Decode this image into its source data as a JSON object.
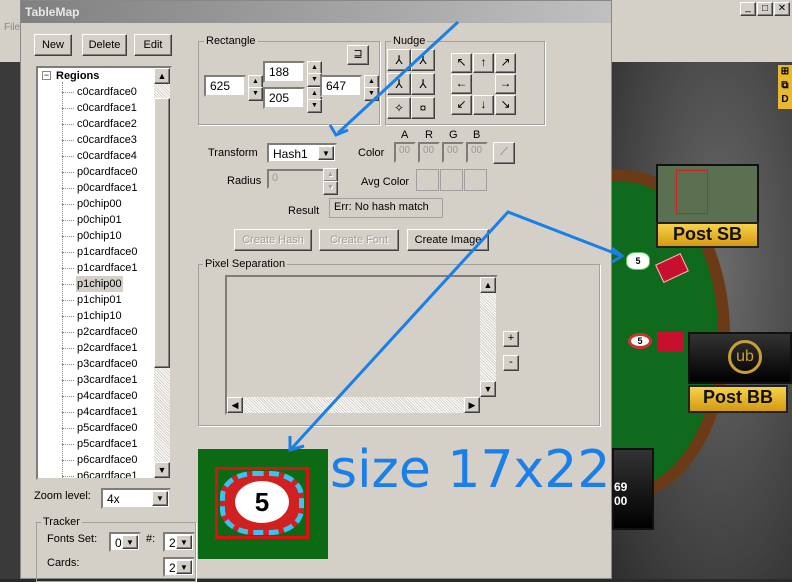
{
  "window": {
    "title": "TableMap",
    "menu_file": "File",
    "min": "_",
    "max": "□",
    "close": "✕"
  },
  "toolbar": {
    "new": "New",
    "delete": "Delete",
    "edit": "Edit"
  },
  "tree": {
    "root": "Regions",
    "items": [
      "c0cardface0",
      "c0cardface1",
      "c0cardface2",
      "c0cardface3",
      "c0cardface4",
      "p0cardface0",
      "p0cardface1",
      "p0chip00",
      "p0chip01",
      "p0chip10",
      "p1cardface0",
      "p1cardface1",
      "p1chip00",
      "p1chip01",
      "p1chip10",
      "p2cardface0",
      "p2cardface1",
      "p3cardface0",
      "p3cardface1",
      "p4cardface0",
      "p4cardface1",
      "p5cardface0",
      "p5cardface1",
      "p6cardface0",
      "p6cardface1"
    ],
    "selected": "p1chip00"
  },
  "rectangle": {
    "label": "Rectangle",
    "left": "625",
    "top": "188",
    "bottom": "205",
    "right": "647"
  },
  "nudge": {
    "label": "Nudge",
    "arrows": [
      "↖",
      "↑",
      "↗",
      "←",
      "",
      "→",
      "↙",
      "↓",
      "↘"
    ],
    "sizers": [
      "⅄",
      "⅄",
      "⅄",
      "⅄",
      "✧",
      "¤"
    ]
  },
  "transform": {
    "label": "Transform",
    "value": "Hash1",
    "radius_label": "Radius",
    "radius": "0",
    "result_label": "Result",
    "result": "Err: No hash match"
  },
  "color": {
    "label": "Color",
    "channels": [
      "A",
      "R",
      "G",
      "B"
    ],
    "values": [
      "00",
      "00",
      "00",
      "00"
    ],
    "avg_label": "Avg Color"
  },
  "buttons": {
    "create_hash": "Create Hash",
    "create_font": "Create Font",
    "create_image": "Create Image"
  },
  "pixel_sep": {
    "label": "Pixel Separation",
    "plus": "+",
    "minus": "-"
  },
  "zoom": {
    "label": "Zoom level:",
    "value": "4x"
  },
  "tracker": {
    "label": "Tracker",
    "fonts_set_label": "Fonts Set:",
    "fonts_set": "0",
    "num_label": "#:",
    "num": "2",
    "cards_label": "Cards:",
    "cards": "2"
  },
  "annotation": {
    "size": "size 17x22",
    "chip_value": "5"
  },
  "poker": {
    "post_sb": "Post SB",
    "post_bb": "Post BB",
    "stack1": "69",
    "stack2": "00",
    "side_icon_d": "D",
    "logo": "ub"
  },
  "colors": {
    "arrow": "#1a7fe8",
    "felt": "#0f6a1e"
  }
}
